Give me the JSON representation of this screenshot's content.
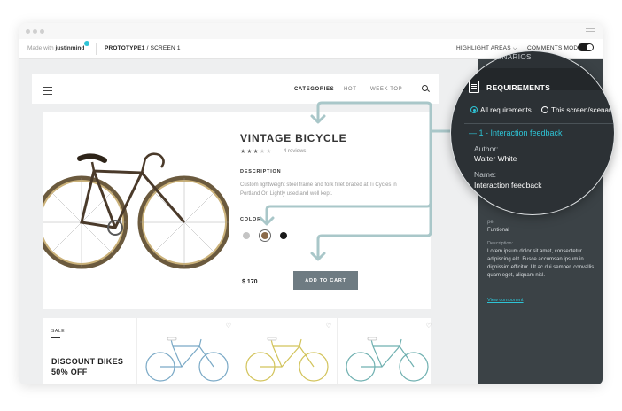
{
  "app": {
    "made_with": "Made with",
    "brand": "justinmind",
    "screen_prefix": "PROTOTYPE1",
    "screen_name": " / SCREEN 1",
    "highlight_areas": "HIGHLIGHT AREAS ⌵",
    "comments_mode": "COMMENTS MODE",
    "brand_color": "#2ec4d6"
  },
  "nav": {
    "links": [
      "CATEGORIES",
      "HOT",
      "WEEK TOP"
    ],
    "active": "CATEGORIES"
  },
  "product": {
    "title": "VINTAGE BICYCLE",
    "rating": 3,
    "rating_max": 5,
    "reviews": "4 reviews",
    "description_heading": "DESCRIPTION",
    "description": "Custom lightweight steel frame and fork fillet brazed at Ti Cycles in Portland Or. Lightly used and well kept.",
    "color_heading": "COLOR",
    "colors": [
      "#c4c4c4",
      "#8a6a4a",
      "#1a1a1a"
    ],
    "price": "$ 170",
    "add_to_cart": "ADD TO CART"
  },
  "listing": {
    "sale": "SALE",
    "discount_line1": "DISCOUNT BIKES",
    "discount_line2": "50% OFF",
    "bike_colors": [
      "#7aa9c6",
      "#d2c35a",
      "#6fb0b0"
    ]
  },
  "panel": {
    "scenarios": "SCENARIOS",
    "requirements_title": "REQUIREMENTS",
    "filter_all": "All requirements",
    "filter_screen": "This screen/scenario",
    "feedback_title": "— 1 - Interaction feedback",
    "author_label": "Author:",
    "author_value": "Walter White",
    "name_label": "Name:",
    "name_value": "Interaction feedback",
    "type_label": "pe:",
    "type_value": "Funtional",
    "description_label": "Description:",
    "description_value": "Lorem ipsum dolor sit amet, consectetur adipiscing elit. Fusce accumsan ipsum in dignissim efficitur. Ut ac dui semper, convallis quam eget, aliquam nisl.",
    "view_component": "View component"
  }
}
